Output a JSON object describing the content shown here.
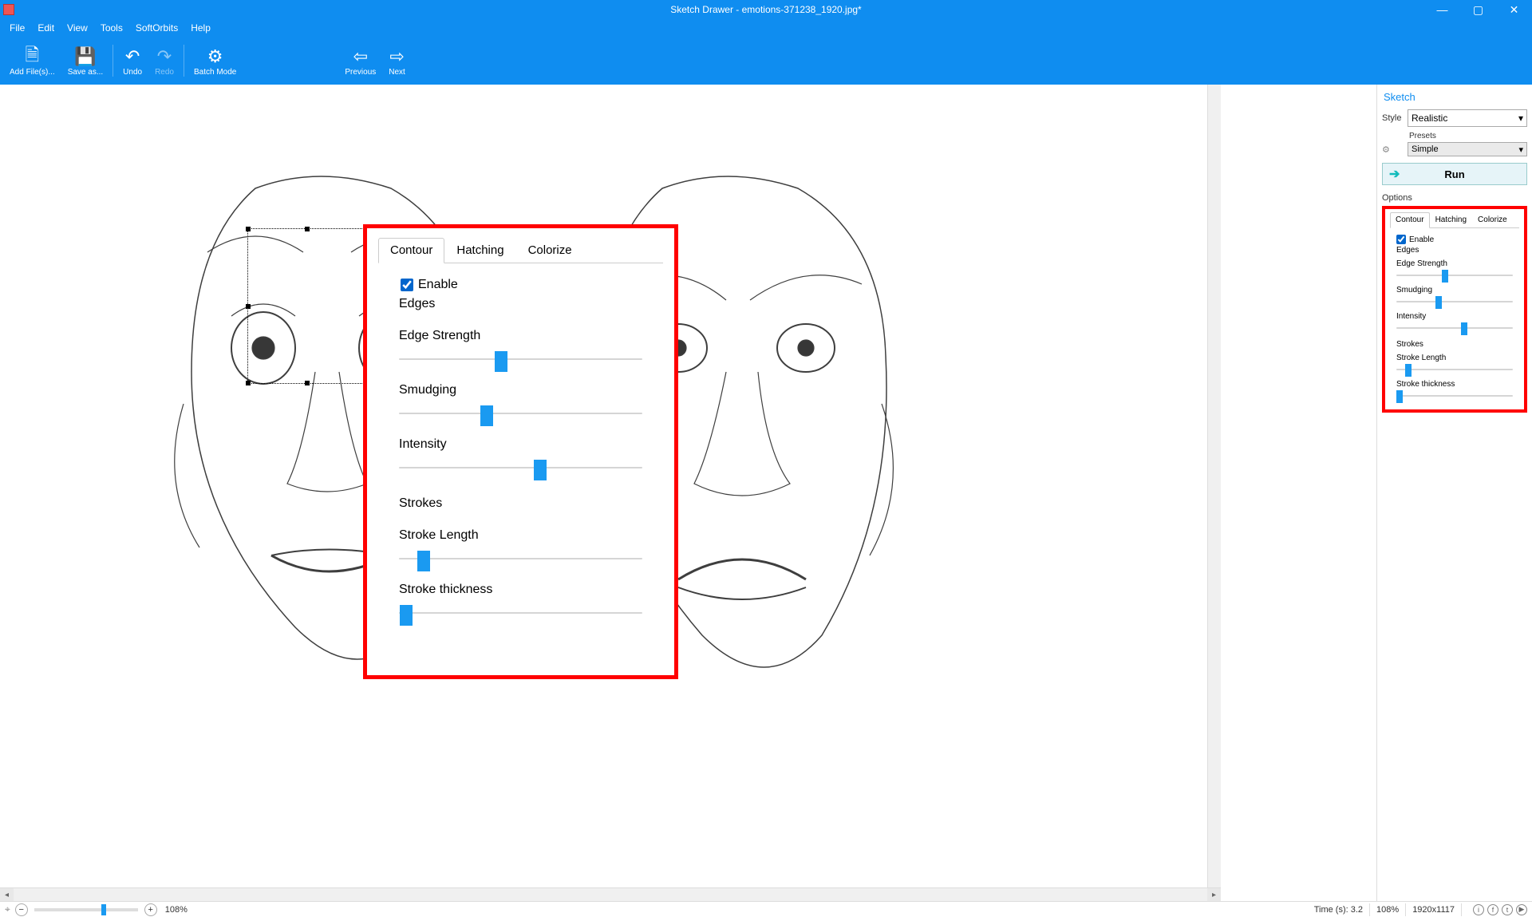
{
  "titlebar": {
    "title": "Sketch Drawer - emotions-371238_1920.jpg*"
  },
  "menu": {
    "file": "File",
    "edit": "Edit",
    "view": "View",
    "tools": "Tools",
    "softorbits": "SoftOrbits",
    "help": "Help"
  },
  "toolbar": {
    "add": "Add File(s)...",
    "save": "Save as...",
    "undo": "Undo",
    "redo": "Redo",
    "batch": "Batch Mode",
    "previous": "Previous",
    "next": "Next"
  },
  "overlay": {
    "tabs": {
      "contour": "Contour",
      "hatching": "Hatching",
      "colorize": "Colorize"
    },
    "enable": "Enable",
    "edges": "Edges",
    "edge_strength": "Edge Strength",
    "smudging": "Smudging",
    "intensity": "Intensity",
    "strokes": "Strokes",
    "stroke_length": "Stroke Length",
    "stroke_thickness": "Stroke thickness",
    "values": {
      "edge_strength": 42,
      "smudging": 36,
      "intensity": 58,
      "stroke_length": 10,
      "stroke_thickness": 3
    }
  },
  "right": {
    "sketch": "Sketch",
    "style_label": "Style",
    "style_value": "Realistic",
    "presets_label": "Presets",
    "presets_value": "Simple",
    "run": "Run",
    "options": "Options",
    "tabs": {
      "contour": "Contour",
      "hatching": "Hatching",
      "colorize": "Colorize"
    },
    "enable": "Enable",
    "edges": "Edges",
    "edge_strength": "Edge Strength",
    "smudging": "Smudging",
    "intensity": "Intensity",
    "strokes": "Strokes",
    "stroke_length": "Stroke Length",
    "stroke_thickness": "Stroke thickness",
    "values": {
      "edge_strength": 42,
      "smudging": 36,
      "intensity": 58,
      "stroke_length": 10,
      "stroke_thickness": 3
    }
  },
  "status": {
    "zoom_pct": "108%",
    "time": "Time (s): 3.2",
    "zoom_right": "108%",
    "dims": "1920x1117"
  }
}
